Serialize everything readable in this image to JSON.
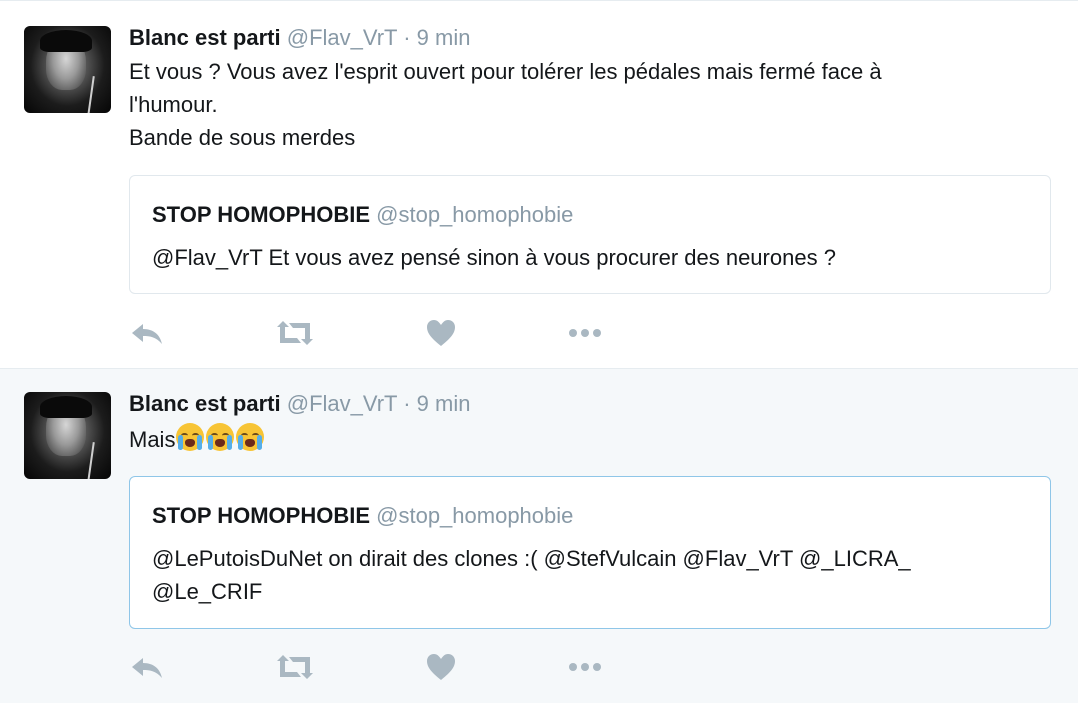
{
  "tweets": [
    {
      "author": {
        "name": "Blanc est parti",
        "handle": "@Flav_VrT",
        "sep": "·",
        "time": "9 min"
      },
      "text_lines": [
        "Et vous ? Vous avez l'esprit ouvert pour tolérer les pédales mais fermé face à",
        "l'humour.",
        "Bande de sous merdes"
      ],
      "quote": {
        "name": "STOP HOMOPHOBIE",
        "handle": "@stop_homophobie",
        "text_lines": [
          "@Flav_VrT Et vous avez pensé sinon à vous procurer des neurones ?"
        ]
      }
    },
    {
      "author": {
        "name": "Blanc est parti",
        "handle": "@Flav_VrT",
        "sep": "·",
        "time": "9 min"
      },
      "text": "Mais",
      "emojis": [
        "loudly-crying-face",
        "loudly-crying-face",
        "loudly-crying-face"
      ],
      "quote": {
        "name": "STOP HOMOPHOBIE",
        "handle": "@stop_homophobie",
        "text_lines": [
          "@LePutoisDuNet on dirait des clones :( @StefVulcain @Flav_VrT @_LICRA_",
          "@Le_CRIF"
        ]
      }
    }
  ],
  "action_icons": [
    "reply-icon",
    "retweet-icon",
    "like-icon",
    "more-icon"
  ],
  "colors": {
    "muted": "#8899a6",
    "text": "#14171a",
    "icon": "#aab8c2",
    "highlight_bg": "#f5f8fa",
    "quote_border": "#e1e8ed",
    "quote_border_active": "#8fc6e8",
    "emoji": "#f7c435"
  }
}
